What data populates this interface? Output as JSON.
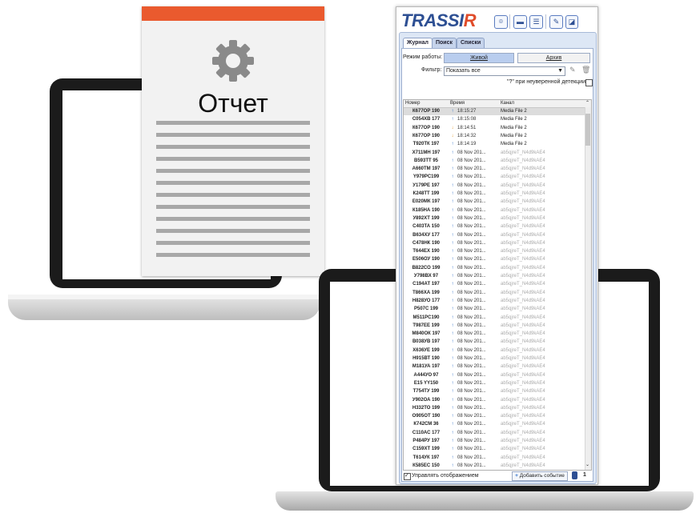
{
  "report_doc": {
    "title": "Отчет",
    "accent": "#ea5a2e"
  },
  "app": {
    "logo": "TRASSIR",
    "toolbar_icons": [
      "video-icon",
      "chat-icon",
      "list-icon",
      "wand-icon",
      "layout-icon"
    ],
    "tabs": [
      "Журнал",
      "Поиск",
      "Списки"
    ],
    "mode_label": "Режим работы:",
    "mode_live": "Живой",
    "mode_archive": "Архив",
    "filter_label": "Фильтр:",
    "filter_value": "Показать все",
    "uncertain_label": "\"?\" при неуверенной детекции",
    "columns": {
      "number": "Номер",
      "time": "Время",
      "channel": "Канал"
    },
    "rows": [
      {
        "num": "К677ОР 190",
        "dir": "up",
        "time": "18:15:27",
        "channel": "Media File 2",
        "sel": true
      },
      {
        "num": "С054ХВ 177",
        "dir": "up",
        "time": "18:15:08",
        "channel": "Media File 2"
      },
      {
        "num": "К677ОР 190",
        "dir": "down",
        "time": "18:14:51",
        "channel": "Media File 2"
      },
      {
        "num": "К677ОР 190",
        "dir": "down",
        "time": "18:14:32",
        "channel": "Media File 2"
      },
      {
        "num": "Т920ТК 197",
        "dir": "up",
        "time": "18:14:19",
        "channel": "Media File 2"
      },
      {
        "num": "Х711МН 197",
        "dir": "up",
        "time": "08 Nov 201...",
        "channel": "ab5qjreT_N4d9kAE4"
      },
      {
        "num": "В593ТТ 95",
        "dir": "up",
        "time": "08 Nov 201...",
        "channel": "ab5qjreT_N4d9kAE4"
      },
      {
        "num": "А660ТМ 197",
        "dir": "up",
        "time": "08 Nov 201...",
        "channel": "ab5qjreT_N4d9kAE4"
      },
      {
        "num": "Y979PC199",
        "dir": "up",
        "time": "08 Nov 201...",
        "channel": "ab5qjreT_N4d9kAE4"
      },
      {
        "num": "У179РЕ 197",
        "dir": "up",
        "time": "08 Nov 201...",
        "channel": "ab5qjreT_N4d9kAE4"
      },
      {
        "num": "К248ТТ 199",
        "dir": "up",
        "time": "08 Nov 201...",
        "channel": "ab5qjreT_N4d9kAE4"
      },
      {
        "num": "Е020МК 197",
        "dir": "up",
        "time": "08 Nov 201...",
        "channel": "ab5qjreT_N4d9kAE4"
      },
      {
        "num": "К185НА 190",
        "dir": "up",
        "time": "08 Nov 201...",
        "channel": "ab5qjreT_N4d9kAE4"
      },
      {
        "num": "У892ХТ 199",
        "dir": "up",
        "time": "08 Nov 201...",
        "channel": "ab5qjreT_N4d9kAE4"
      },
      {
        "num": "С403ТА 150",
        "dir": "up",
        "time": "08 Nov 201...",
        "channel": "ab5qjreT_N4d9kAE4"
      },
      {
        "num": "В634ХУ 177",
        "dir": "up",
        "time": "08 Nov 201...",
        "channel": "ab5qjreT_N4d9kAE4"
      },
      {
        "num": "С478НК 190",
        "dir": "up",
        "time": "08 Nov 201...",
        "channel": "ab5qjreT_N4d9kAE4"
      },
      {
        "num": "Т644ЕХ 190",
        "dir": "up",
        "time": "08 Nov 201...",
        "channel": "ab5qjreT_N4d9kAE4"
      },
      {
        "num": "Е506ОУ 190",
        "dir": "up",
        "time": "08 Nov 201...",
        "channel": "ab5qjreT_N4d9kAE4"
      },
      {
        "num": "В822СО 199",
        "dir": "up",
        "time": "08 Nov 201...",
        "channel": "ab5qjreT_N4d9kAE4"
      },
      {
        "num": "У798ВХ 97",
        "dir": "up",
        "time": "08 Nov 201...",
        "channel": "ab5qjreT_N4d9kAE4"
      },
      {
        "num": "С194АТ 197",
        "dir": "up",
        "time": "08 Nov 201...",
        "channel": "ab5qjreT_N4d9kAE4"
      },
      {
        "num": "Т866ХА 199",
        "dir": "up",
        "time": "08 Nov 201...",
        "channel": "ab5qjreT_N4d9kAE4"
      },
      {
        "num": "Н828УО 177",
        "dir": "up",
        "time": "08 Nov 201...",
        "channel": "ab5qjreT_N4d9kAE4"
      },
      {
        "num": "Р507С 199",
        "dir": "up",
        "time": "08 Nov 201...",
        "channel": "ab5qjreT_N4d9kAE4"
      },
      {
        "num": "M511PC190",
        "dir": "up",
        "time": "08 Nov 201...",
        "channel": "ab5qjreT_N4d9kAE4"
      },
      {
        "num": "Т987ЕЕ 199",
        "dir": "up",
        "time": "08 Nov 201...",
        "channel": "ab5qjreT_N4d9kAE4"
      },
      {
        "num": "М840ОК 197",
        "dir": "up",
        "time": "08 Nov 201...",
        "channel": "ab5qjreT_N4d9kAE4"
      },
      {
        "num": "В038УВ 197",
        "dir": "up",
        "time": "08 Nov 201...",
        "channel": "ab5qjreT_N4d9kAE4"
      },
      {
        "num": "Х636УЕ 199",
        "dir": "up",
        "time": "08 Nov 201...",
        "channel": "ab5qjreT_N4d9kAE4"
      },
      {
        "num": "Н915ВТ 190",
        "dir": "up",
        "time": "08 Nov 201...",
        "channel": "ab5qjreT_N4d9kAE4"
      },
      {
        "num": "М181УА 197",
        "dir": "up",
        "time": "08 Nov 201...",
        "channel": "ab5qjreT_N4d9kAE4"
      },
      {
        "num": "А444УО 97",
        "dir": "up",
        "time": "08 Nov 201...",
        "channel": "ab5qjreT_N4d9kAE4"
      },
      {
        "num": "E15 YY150",
        "dir": "up",
        "time": "08 Nov 201...",
        "channel": "ab5qjreT_N4d9kAE4"
      },
      {
        "num": "Т754ТУ 199",
        "dir": "up",
        "time": "08 Nov 201...",
        "channel": "ab5qjreT_N4d9kAE4"
      },
      {
        "num": "У902ОА 190",
        "dir": "up",
        "time": "08 Nov 201...",
        "channel": "ab5qjreT_N4d9kAE4"
      },
      {
        "num": "Н332ТО 199",
        "dir": "up",
        "time": "08 Nov 201...",
        "channel": "ab5qjreT_N4d9kAE4"
      },
      {
        "num": "О905ОТ 190",
        "dir": "up",
        "time": "08 Nov 201...",
        "channel": "ab5qjreT_N4d9kAE4"
      },
      {
        "num": "К742СМ 36",
        "dir": "up",
        "time": "08 Nov 201...",
        "channel": "ab5qjreT_N4d9kAE4"
      },
      {
        "num": "С110АС 177",
        "dir": "up",
        "time": "08 Nov 201...",
        "channel": "ab5qjreT_N4d9kAE4"
      },
      {
        "num": "Р484РУ 197",
        "dir": "up",
        "time": "08 Nov 201...",
        "channel": "ab5qjreT_N4d9kAE4"
      },
      {
        "num": "С159ХТ 199",
        "dir": "up",
        "time": "08 Nov 201...",
        "channel": "ab5qjreT_N4d9kAE4"
      },
      {
        "num": "Т614УК 197",
        "dir": "up",
        "time": "08 Nov 201...",
        "channel": "ab5qjreT_N4d9kAE4"
      },
      {
        "num": "К585ЕС 150",
        "dir": "up",
        "time": "08 Nov 201...",
        "channel": "ab5qjreT_N4d9kAE4"
      }
    ],
    "footer_manage": "Управлять отображением",
    "add_event": "Добавить событие",
    "count": "1",
    "colors": {
      "brand": "#2d4f93",
      "brand_r": "#e04c2a",
      "arrow_up": "#2a6cc8",
      "arrow_down": "#e49a2a",
      "panel": "#dde7f5"
    }
  }
}
